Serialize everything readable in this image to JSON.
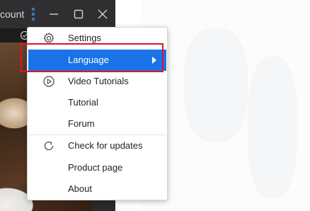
{
  "window": {
    "title": "count"
  },
  "menu": {
    "items": [
      {
        "label": "Settings",
        "icon": "gear-icon"
      },
      {
        "label": "Language",
        "icon": "",
        "submenu": true,
        "active": true
      },
      {
        "label": "Video Tutorials",
        "icon": "play-circle-icon"
      },
      {
        "label": "Tutorial",
        "icon": ""
      },
      {
        "label": "Forum",
        "icon": ""
      },
      {
        "label": "Check for updates",
        "icon": "refresh-icon"
      },
      {
        "label": "Product page",
        "icon": ""
      },
      {
        "label": "About",
        "icon": ""
      }
    ]
  },
  "colors": {
    "accent": "#1a73e8",
    "highlight_border": "#e1141d",
    "titlebar": "#2f2f31"
  }
}
